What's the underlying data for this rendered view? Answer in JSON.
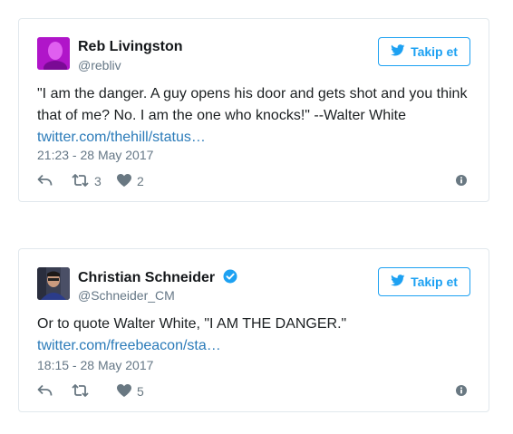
{
  "tweets": [
    {
      "name": "Reb Livingston",
      "handle": "@rebliv",
      "verified": false,
      "follow_label": "Takip et",
      "text": "\"I am the danger. A guy opens his door and gets shot and you think that of me? No. I am the one who knocks!\" --Walter White",
      "link": "twitter.com/thehill/status…",
      "date": "21:23 - 28 May 2017",
      "retweets": "3",
      "likes": "2"
    },
    {
      "name": "Christian Schneider",
      "handle": "@Schneider_CM",
      "verified": true,
      "follow_label": "Takip et",
      "text": "Or to quote Walter White, \"I AM THE DANGER.\"",
      "link": "twitter.com/freebeacon/sta…",
      "date": "18:15 - 28 May 2017",
      "retweets": "",
      "likes": "5"
    }
  ],
  "colors": {
    "accent": "#1da1f2",
    "link": "#2b7bb9",
    "muted": "#657786",
    "border": "#e1e8ed"
  }
}
